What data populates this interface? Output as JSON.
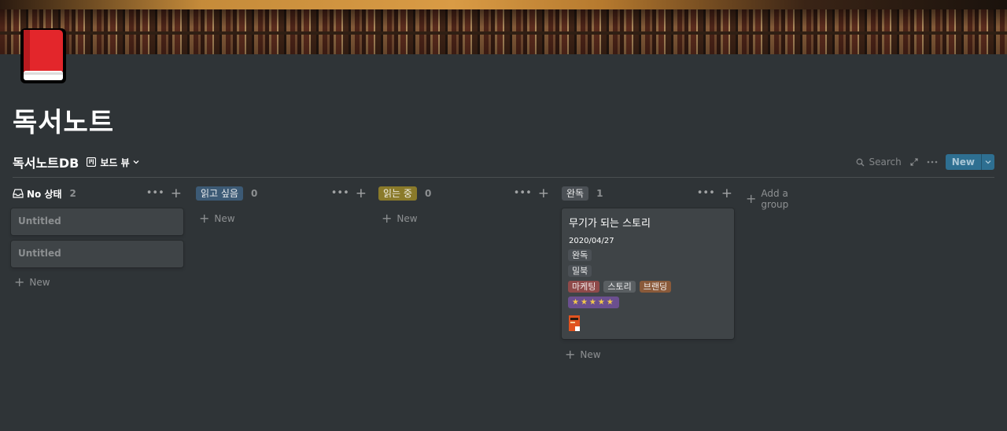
{
  "page": {
    "title": "독서노트",
    "icon": "red-book-icon"
  },
  "database": {
    "title": "독서노트DB",
    "view_label": "보드 뷰",
    "search_label": "Search",
    "new_label": "New"
  },
  "colors": {
    "background": "#2f3437",
    "card": "#3f4447",
    "accent_blue": "#2e6f91"
  },
  "columns": [
    {
      "label": "No 상태",
      "count": "2",
      "tag_color": "",
      "cards": [
        "Untitled",
        "Untitled"
      ],
      "new_label": "New"
    },
    {
      "label": "읽고 싶음",
      "count": "0",
      "tag_color": "#3c5a75",
      "cards": [],
      "new_label": "New"
    },
    {
      "label": "읽는 중",
      "count": "0",
      "tag_color": "#8a7a2a",
      "cards": [],
      "new_label": "New"
    },
    {
      "label": "완독",
      "count": "1",
      "tag_color": "#4b5055",
      "new_label": "New",
      "card": {
        "title": "무기가 되는 스토리",
        "date": "2020/04/27",
        "status": "완독",
        "format": "밀북",
        "tags": [
          {
            "label": "마케팅",
            "color": "#8f4a4a"
          },
          {
            "label": "스토리",
            "color": "#5a5f62"
          },
          {
            "label": "브랜딩",
            "color": "#8a5a3a"
          }
        ],
        "rating": "★★★★★",
        "rating_color": "#6b4f8f"
      }
    }
  ],
  "add_group_label": "Add a group"
}
